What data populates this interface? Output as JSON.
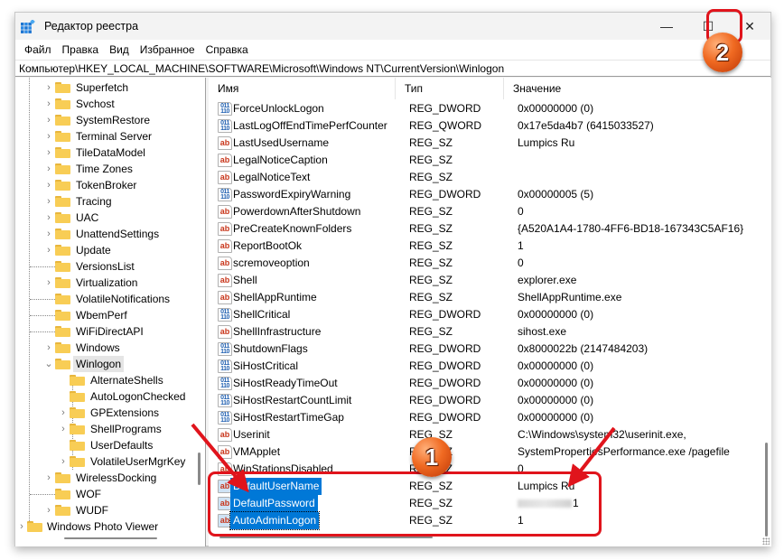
{
  "window": {
    "title": "Редактор реестра",
    "icon": "registry-editor-icon",
    "controls": {
      "minimize": "—",
      "maximize": "☐",
      "close": "✕"
    }
  },
  "menu": [
    "Файл",
    "Правка",
    "Вид",
    "Избранное",
    "Справка"
  ],
  "address": "Компьютер\\HKEY_LOCAL_MACHINE\\SOFTWARE\\Microsoft\\Windows NT\\CurrentVersion\\Winlogon",
  "tree": [
    {
      "label": "Superfetch",
      "expander": "collapsed",
      "level": 1
    },
    {
      "label": "Svchost",
      "expander": "collapsed",
      "level": 1
    },
    {
      "label": "SystemRestore",
      "expander": "collapsed",
      "level": 1
    },
    {
      "label": "Terminal Server",
      "expander": "collapsed",
      "level": 1
    },
    {
      "label": "TileDataModel",
      "expander": "collapsed",
      "level": 1
    },
    {
      "label": "Time Zones",
      "expander": "collapsed",
      "level": 1
    },
    {
      "label": "TokenBroker",
      "expander": "collapsed",
      "level": 1
    },
    {
      "label": "Tracing",
      "expander": "collapsed",
      "level": 1
    },
    {
      "label": "UAC",
      "expander": "collapsed",
      "level": 1
    },
    {
      "label": "UnattendSettings",
      "expander": "collapsed",
      "level": 1
    },
    {
      "label": "Update",
      "expander": "collapsed",
      "level": 1
    },
    {
      "label": "VersionsList",
      "expander": "none",
      "level": 1
    },
    {
      "label": "Virtualization",
      "expander": "collapsed",
      "level": 1
    },
    {
      "label": "VolatileNotifications",
      "expander": "none",
      "level": 1
    },
    {
      "label": "WbemPerf",
      "expander": "none",
      "level": 1
    },
    {
      "label": "WiFiDirectAPI",
      "expander": "none",
      "level": 1
    },
    {
      "label": "Windows",
      "expander": "collapsed",
      "level": 1
    },
    {
      "label": "Winlogon",
      "expander": "expanded",
      "level": 1,
      "selected": true
    },
    {
      "label": "AlternateShells",
      "expander": "none",
      "level": 2
    },
    {
      "label": "AutoLogonChecked",
      "expander": "none",
      "level": 2
    },
    {
      "label": "GPExtensions",
      "expander": "collapsed",
      "level": 2
    },
    {
      "label": "ShellPrograms",
      "expander": "collapsed",
      "level": 2
    },
    {
      "label": "UserDefaults",
      "expander": "none",
      "level": 2
    },
    {
      "label": "VolatileUserMgrKey",
      "expander": "collapsed",
      "level": 2
    },
    {
      "label": "WirelessDocking",
      "expander": "collapsed",
      "level": 1
    },
    {
      "label": "WOF",
      "expander": "none",
      "level": 1
    },
    {
      "label": "WUDF",
      "expander": "collapsed",
      "level": 1
    },
    {
      "label": "Windows Photo Viewer",
      "expander": "collapsed",
      "level": 0
    }
  ],
  "columns": {
    "name": "Имя",
    "type": "Тип",
    "value": "Значение"
  },
  "values": [
    {
      "name": "ForceUnlockLogon",
      "type": "REG_DWORD",
      "data": "0x00000000 (0)",
      "icon": "binary"
    },
    {
      "name": "LastLogOffEndTimePerfCounter",
      "type": "REG_QWORD",
      "data": "0x17e5da4b7 (6415033527)",
      "icon": "binary"
    },
    {
      "name": "LastUsedUsername",
      "type": "REG_SZ",
      "data": "Lumpics Ru",
      "icon": "string"
    },
    {
      "name": "LegalNoticeCaption",
      "type": "REG_SZ",
      "data": "",
      "icon": "string"
    },
    {
      "name": "LegalNoticeText",
      "type": "REG_SZ",
      "data": "",
      "icon": "string"
    },
    {
      "name": "PasswordExpiryWarning",
      "type": "REG_DWORD",
      "data": "0x00000005 (5)",
      "icon": "binary"
    },
    {
      "name": "PowerdownAfterShutdown",
      "type": "REG_SZ",
      "data": "0",
      "icon": "string"
    },
    {
      "name": "PreCreateKnownFolders",
      "type": "REG_SZ",
      "data": "{A520A1A4-1780-4FF6-BD18-167343C5AF16}",
      "icon": "string"
    },
    {
      "name": "ReportBootOk",
      "type": "REG_SZ",
      "data": "1",
      "icon": "string"
    },
    {
      "name": "scremoveoption",
      "type": "REG_SZ",
      "data": "0",
      "icon": "string"
    },
    {
      "name": "Shell",
      "type": "REG_SZ",
      "data": "explorer.exe",
      "icon": "string"
    },
    {
      "name": "ShellAppRuntime",
      "type": "REG_SZ",
      "data": "ShellAppRuntime.exe",
      "icon": "string"
    },
    {
      "name": "ShellCritical",
      "type": "REG_DWORD",
      "data": "0x00000000 (0)",
      "icon": "binary"
    },
    {
      "name": "ShellInfrastructure",
      "type": "REG_SZ",
      "data": "sihost.exe",
      "icon": "string"
    },
    {
      "name": "ShutdownFlags",
      "type": "REG_DWORD",
      "data": "0x8000022b (2147484203)",
      "icon": "binary"
    },
    {
      "name": "SiHostCritical",
      "type": "REG_DWORD",
      "data": "0x00000000 (0)",
      "icon": "binary"
    },
    {
      "name": "SiHostReadyTimeOut",
      "type": "REG_DWORD",
      "data": "0x00000000 (0)",
      "icon": "binary"
    },
    {
      "name": "SiHostRestartCountLimit",
      "type": "REG_DWORD",
      "data": "0x00000000 (0)",
      "icon": "binary"
    },
    {
      "name": "SiHostRestartTimeGap",
      "type": "REG_DWORD",
      "data": "0x00000000 (0)",
      "icon": "binary"
    },
    {
      "name": "Userinit",
      "type": "REG_SZ",
      "data": "C:\\Windows\\system32\\userinit.exe,",
      "icon": "string"
    },
    {
      "name": "VMApplet",
      "type": "REG_SZ",
      "data": "SystemPropertiesPerformance.exe /pagefile",
      "icon": "string"
    },
    {
      "name": "WinStationsDisabled",
      "type": "REG_SZ",
      "data": "0",
      "icon": "string"
    },
    {
      "name": "DefaultUserName",
      "type": "REG_SZ",
      "data": "Lumpics Ru",
      "icon": "string",
      "selected": true
    },
    {
      "name": "DefaultPassword",
      "type": "REG_SZ",
      "data": "1",
      "data_obscured": true,
      "icon": "string",
      "selected": true
    },
    {
      "name": "AutoAdminLogon",
      "type": "REG_SZ",
      "data": "1",
      "icon": "string",
      "selected": true,
      "focused": true
    }
  ],
  "annotations": {
    "step1": "1",
    "step2": "2",
    "color": "#e0141c"
  }
}
